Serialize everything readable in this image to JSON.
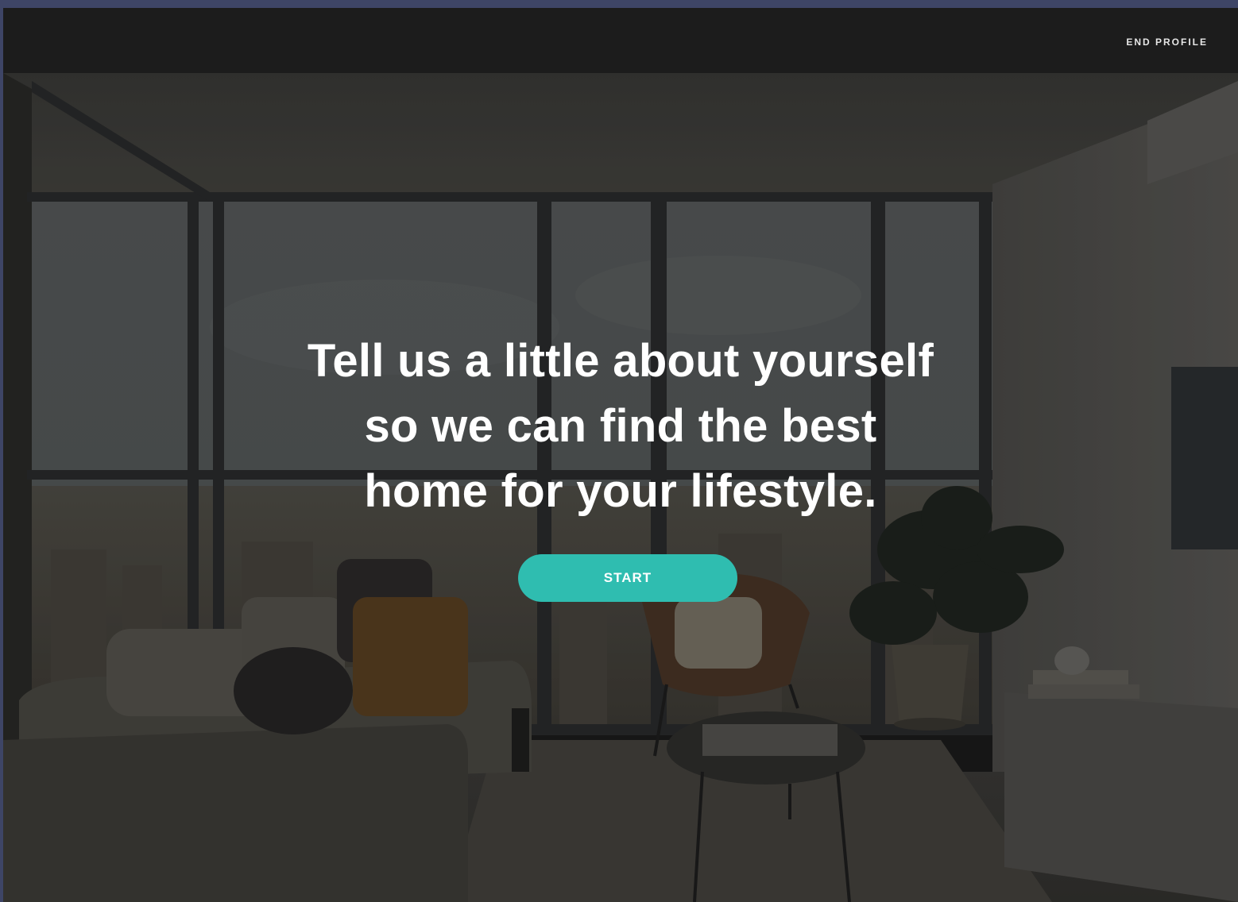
{
  "header": {
    "end_profile_label": "END PROFILE"
  },
  "hero": {
    "headline_lines": [
      "Tell us a little about yourself",
      "so we can find the best",
      "home for your lifestyle."
    ],
    "start_label": "START"
  },
  "colors": {
    "accent": "#2fbdb0",
    "topbar": "#1c1c1c",
    "outer_border": "#3e4566"
  },
  "icons": {
    "background": "living-room-photo"
  }
}
